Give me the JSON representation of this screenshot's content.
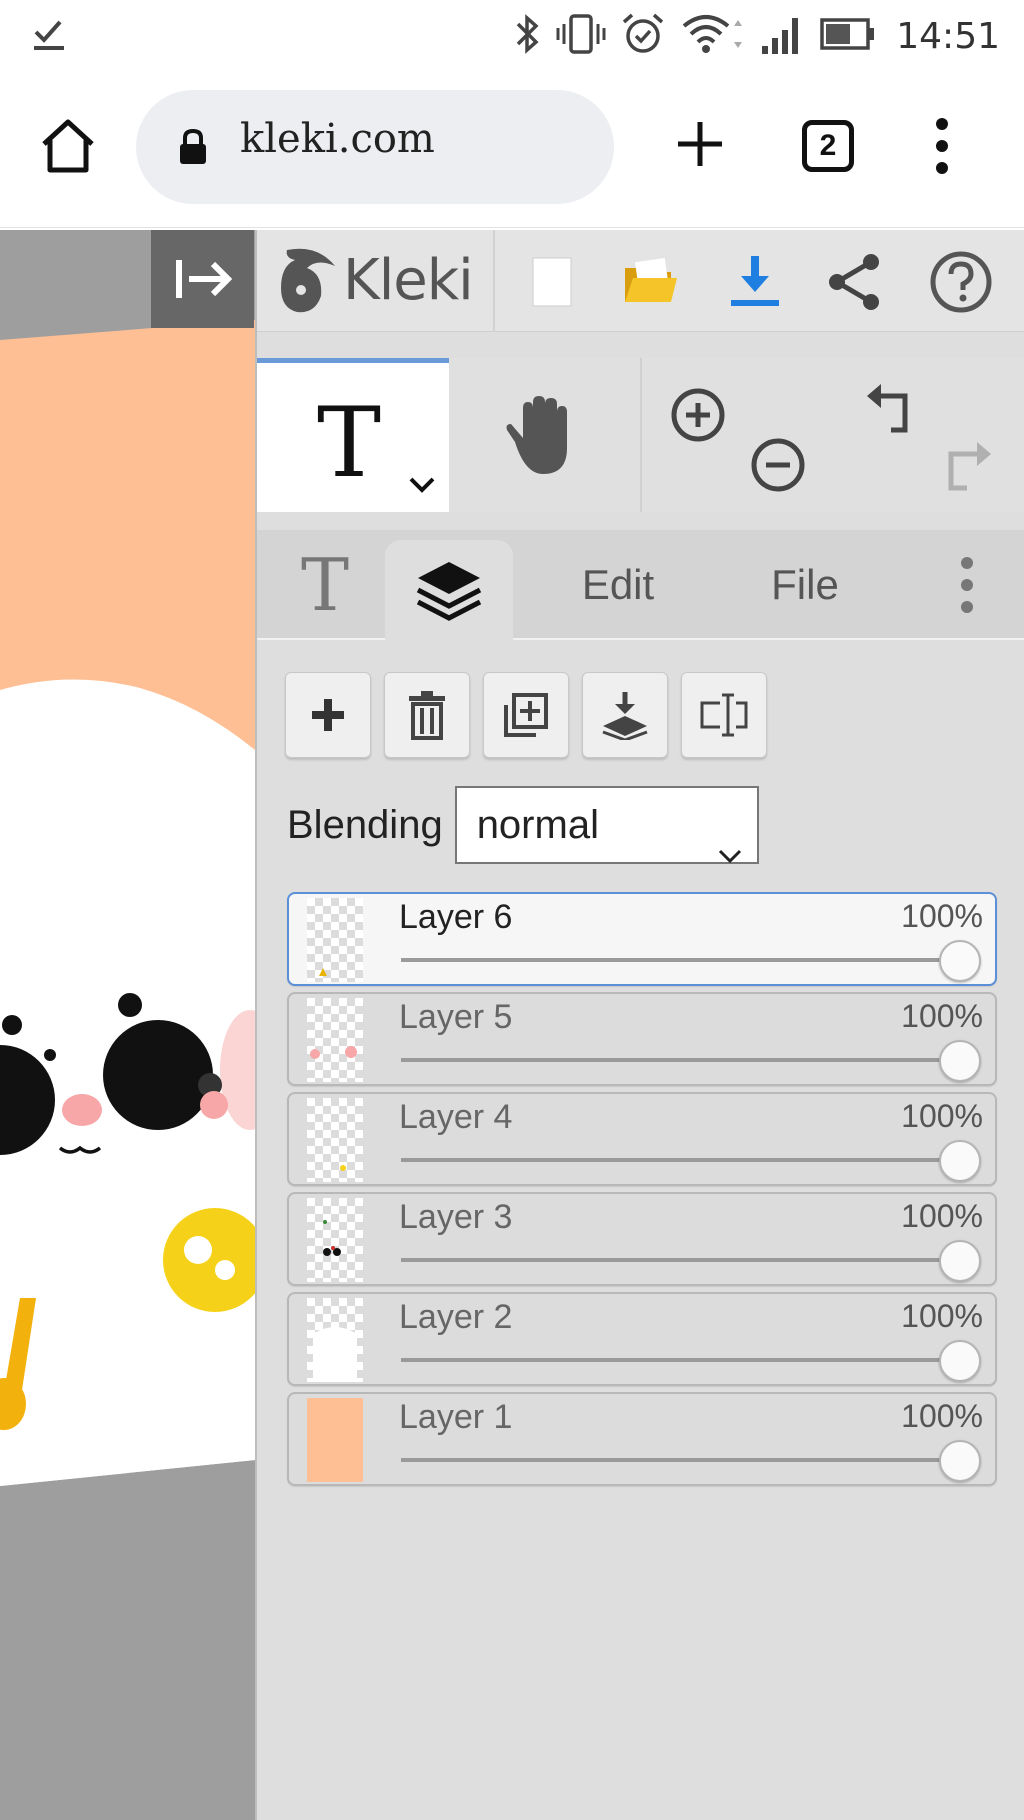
{
  "status_bar": {
    "time": "14:51",
    "icons": [
      "download-check-icon",
      "bluetooth-icon",
      "vibrate-icon",
      "alarm-icon",
      "wifi-icon",
      "signal-icon",
      "battery-icon"
    ]
  },
  "browser": {
    "url": "kleki.com",
    "tab_count": "2",
    "icons": [
      "home-icon",
      "lock-icon",
      "plus-icon",
      "menu-dots-icon"
    ]
  },
  "app": {
    "logo_text": "Kleki",
    "topbar_icons": [
      "new-image-icon",
      "open-folder-icon",
      "download-icon",
      "share-icon",
      "help-icon"
    ],
    "accent_color": "#1e7fe0",
    "tool_text_glyph": "T",
    "tabs": [
      {
        "id": "brush",
        "label": "T"
      },
      {
        "id": "layers",
        "label": ""
      },
      {
        "id": "edit",
        "label": "Edit"
      },
      {
        "id": "file",
        "label": "File"
      }
    ],
    "layer_tool_icons": [
      "add-layer-icon",
      "delete-layer-icon",
      "duplicate-layer-icon",
      "merge-down-icon",
      "rename-layer-icon"
    ],
    "blending": {
      "label": "Blending",
      "value": "normal"
    },
    "layers": [
      {
        "name": "Layer 6",
        "opacity": "100%",
        "opacity_value": 1.0,
        "selected": true
      },
      {
        "name": "Layer 5",
        "opacity": "100%",
        "opacity_value": 1.0,
        "selected": false
      },
      {
        "name": "Layer 4",
        "opacity": "100%",
        "opacity_value": 1.0,
        "selected": false
      },
      {
        "name": "Layer 3",
        "opacity": "100%",
        "opacity_value": 1.0,
        "selected": false
      },
      {
        "name": "Layer 2",
        "opacity": "100%",
        "opacity_value": 1.0,
        "selected": false
      },
      {
        "name": "Layer 1",
        "opacity": "100%",
        "opacity_value": 1.0,
        "selected": false
      }
    ],
    "canvas_colors": {
      "background": "#ffbf95",
      "character": "#ffffff",
      "blush": "#f7a7a7",
      "accent_yellow": "#f5d219"
    }
  }
}
